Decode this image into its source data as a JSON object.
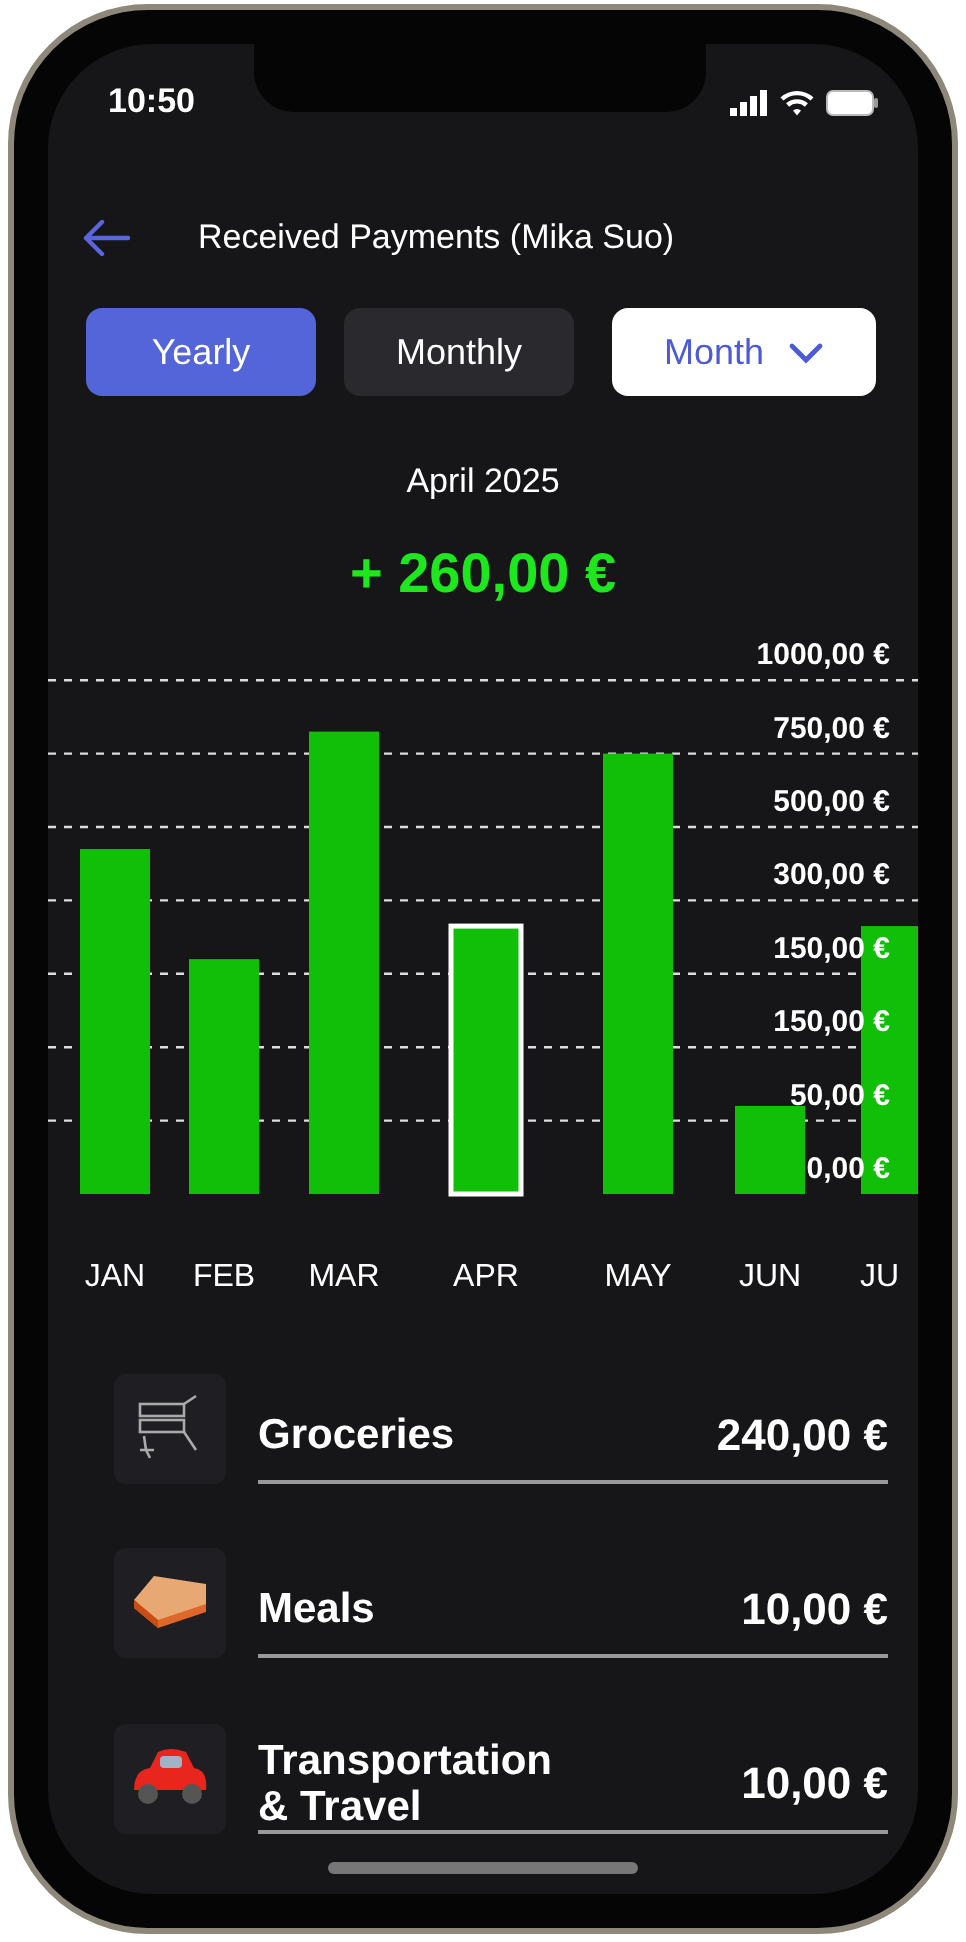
{
  "status_bar": {
    "time": "10:50"
  },
  "header": {
    "title": "Received Payments (Mika Suo)"
  },
  "tabs": [
    {
      "label": "Yearly",
      "selected": true
    },
    {
      "label": "Monthly",
      "selected": false
    }
  ],
  "period_dropdown": {
    "value": "Month"
  },
  "period": "April 2025",
  "total": "+ 260,00 €",
  "chart": {
    "y_labels": [
      "1000,00 €",
      "750,00 €",
      "500,00 €",
      "300,00 €",
      "150,00 €",
      "150,00 €",
      "50,00 €",
      "0,00 €"
    ],
    "months": [
      {
        "label": "JAN",
        "selected": false
      },
      {
        "label": "FEB",
        "selected": false
      },
      {
        "label": "MAR",
        "selected": false
      },
      {
        "label": "APR",
        "selected": true
      },
      {
        "label": "MAY",
        "selected": false
      },
      {
        "label": "JUN",
        "selected": false
      },
      {
        "label": "JU",
        "selected": false
      }
    ]
  },
  "categories": [
    {
      "kind": "cart",
      "name": "Groceries",
      "amount": "240,00 €"
    },
    {
      "kind": "sandwich",
      "name": "Meals",
      "amount": "10,00 €"
    },
    {
      "kind": "car",
      "name": "Transportation & Travel",
      "amount": "10,00 €"
    }
  ]
}
